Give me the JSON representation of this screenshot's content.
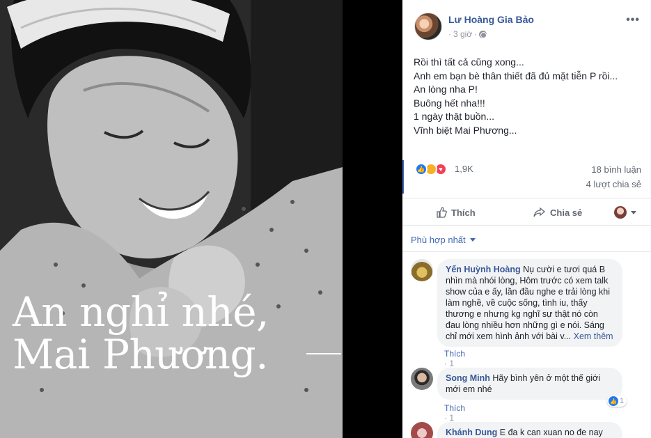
{
  "photo": {
    "caption_line1": "An nghỉ nhé,",
    "caption_line2": "Mai Phương."
  },
  "post": {
    "author": "Lư Hoàng Gia Bảo",
    "time": "3 giờ",
    "privacy_icon": "globe-icon",
    "more_label": "•••",
    "text_lines": [
      "Rồi thì tất cả cũng xong...",
      "Anh em bạn bè thân thiết đã đủ mặt tiễn P rồi...",
      "An lòng nha P!",
      "Buông hết nha!!!",
      "1 ngày thật buồn...",
      "Vĩnh biệt Mai Phương..."
    ],
    "reaction_count": "1,9K",
    "comments_count": "18 bình luận",
    "shares_count": "4 lượt chia sẻ",
    "like_label": "Thích",
    "share_label": "Chia sẻ"
  },
  "sort": {
    "label": "Phù hợp nhất"
  },
  "comments": [
    {
      "name": "Yến Huỳnh Hoàng",
      "text_lines": [
        "Nụ cười e tươi quá B",
        "nhìn mà nhói lòng, Hôm trước có xem talk",
        "show của e ấy, lần đầu nghe e trải lòng khi",
        "làm nghề, về cuộc sống, tình iu, thấy",
        "thương e nhưng kg nghĩ sự thật nó còn",
        "đau lòng nhiều hơn những gì e nói. Sáng",
        "chỉ mới xem hình ảnh với bài v..."
      ],
      "see_more": "Xem thêm",
      "like_label": "Thích",
      "time": "1 giờ"
    },
    {
      "name": "Song Minh",
      "text_lines": [
        "Hãy bình yên ở một thế giới",
        "mới em nhé"
      ],
      "like_label": "Thích",
      "time": "1 giờ",
      "like_count": "1"
    },
    {
      "name": "Khánh Dung",
      "text_partial": "E đa k can xuan no đe nay"
    }
  ],
  "colors": {
    "link": "#385898",
    "accent": "#4267b2",
    "like": "#2078f4",
    "love": "#f33e58",
    "sad": "#f7b125"
  }
}
